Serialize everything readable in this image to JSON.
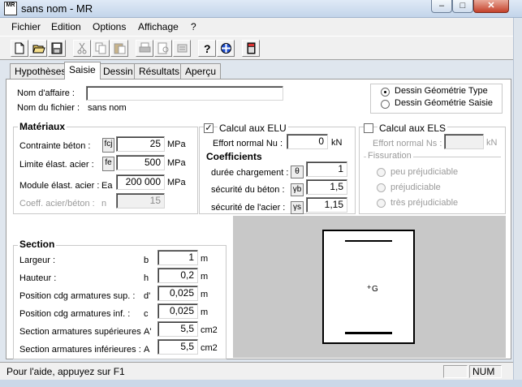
{
  "window": {
    "title": "sans nom - MR",
    "icon_text": "MR"
  },
  "menu": [
    "Fichier",
    "Edition",
    "Options",
    "Affichage",
    "?"
  ],
  "tabs": [
    "Hypothèses",
    "Saisie",
    "Dessin",
    "Résultats",
    "Aperçu"
  ],
  "affaire": {
    "nom_affaire_label": "Nom d'affaire :",
    "nom_affaire_value": "",
    "nom_fichier_label": "Nom du fichier :",
    "nom_fichier_value": "sans nom"
  },
  "dessin_mode": {
    "options": [
      "Dessin Géométrie Type",
      "Dessin Géométrie Saisie"
    ],
    "selected": 0
  },
  "materiaux": {
    "title": "Matériaux",
    "contrainte_label": "Contrainte béton :",
    "contrainte_sym": "fcj",
    "contrainte_value": "25",
    "contrainte_unit": "MPa",
    "limite_label": "Limite élast. acier :",
    "limite_sym": "fe",
    "limite_value": "500",
    "limite_unit": "MPa",
    "module_label": "Module élast. acier :",
    "module_sym": "Ea",
    "module_value": "200 000",
    "module_unit": "MPa",
    "coeff_label": "Coeff. acier/béton :",
    "coeff_sym": "n",
    "coeff_value": "15"
  },
  "elu": {
    "check_label": "Calcul aux ELU",
    "checked": true,
    "effort_label": "Effort normal Nu :",
    "effort_value": "0",
    "effort_unit": "kN",
    "coeff_title": "Coefficients",
    "duree_label": "durée chargement :",
    "duree_sym": "θ",
    "duree_value": "1",
    "secu_beton_label": "sécurité du béton :",
    "secu_beton_sym": "γb",
    "secu_beton_value": "1,5",
    "secu_acier_label": "sécurité de l'acier :",
    "secu_acier_sym": "γs",
    "secu_acier_value": "1,15"
  },
  "els": {
    "check_label": "Calcul aux ELS",
    "checked": false,
    "effort_label": "Effort normal Ns :",
    "effort_value": "",
    "effort_unit": "kN",
    "fissuration_title": "Fissuration",
    "fissuration_options": [
      "peu préjudiciable",
      "préjudiciable",
      "très préjudiciable"
    ]
  },
  "section": {
    "title": "Section",
    "rows": [
      {
        "label": "Largeur :",
        "sym": "b",
        "value": "1",
        "unit": "m"
      },
      {
        "label": "Hauteur :",
        "sym": "h",
        "value": "0,2",
        "unit": "m"
      },
      {
        "label": "Position cdg armatures sup. :",
        "sym": "d'",
        "value": "0,025",
        "unit": "m"
      },
      {
        "label": "Position cdg armatures inf. :",
        "sym": "c",
        "value": "0,025",
        "unit": "m"
      },
      {
        "label": "Section armatures supérieures",
        "sym": "A'",
        "value": "5,5",
        "unit": "cm2"
      },
      {
        "label": "Section armatures inférieures :",
        "sym": "A",
        "value": "5,5",
        "unit": "cm2"
      }
    ]
  },
  "preview": {
    "centroid_label": "G"
  },
  "status": {
    "help_text": "Pour l'aide, appuyez sur F1",
    "num": "NUM"
  },
  "icons": [
    "new-file-icon",
    "open-folder-icon",
    "save-icon",
    "cut-icon",
    "copy-icon",
    "paste-icon",
    "print-icon",
    "print-preview-icon",
    "print-setup-icon",
    "help-icon",
    "context-help-icon",
    "calculator-icon"
  ]
}
